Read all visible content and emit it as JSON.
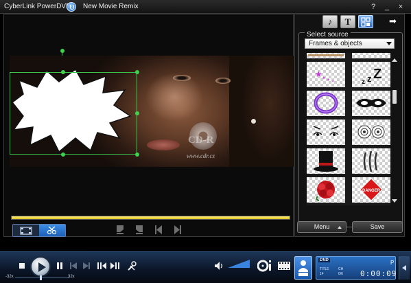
{
  "window": {
    "app_title": "CyberLink PowerDVD",
    "movie_title": "New Movie Remix",
    "help_label": "?",
    "minimize_label": "_",
    "close_label": "×"
  },
  "video": {
    "watermark_logo": "CD-R",
    "watermark_url": "www.cdr.cz"
  },
  "playback": {
    "progress": 1.0
  },
  "side_panel": {
    "tabs": [
      {
        "name": "music-tab",
        "glyph": "♪"
      },
      {
        "name": "text-tab",
        "glyph": "T"
      },
      {
        "name": "objects-tab",
        "glyph": "▦"
      }
    ],
    "next_glyph": "➡",
    "select_source_label": "Select source",
    "source_dropdown_value": "Frames & objects",
    "thumbnails": [
      "sparkle-stars",
      "zzz-sleep",
      "purple-ring-frame",
      "black-eye-mask",
      "cartoon-eyes",
      "swirl-hypno-eyes",
      "top-hat",
      "claw-scratch",
      "red-rose",
      "danger-sign"
    ],
    "danger_sign_text": "DANGER",
    "menu_button_label": "Menu",
    "save_button_label": "Save"
  },
  "controls": {
    "speed_min_label": "-32x",
    "speed_max_label": "32x",
    "volume_level": 0.8
  },
  "info_panel": {
    "disc_label": "DVD",
    "title_label": "TITLE",
    "title_value": "14",
    "chapter_label": "CH",
    "chapter_value": "0/6",
    "time": "0:00:09",
    "corner_label": "P"
  },
  "colors": {
    "accent_blue": "#2d6ac1",
    "selection_green": "#39c44b",
    "progress_yellow": "#e0c21c"
  }
}
